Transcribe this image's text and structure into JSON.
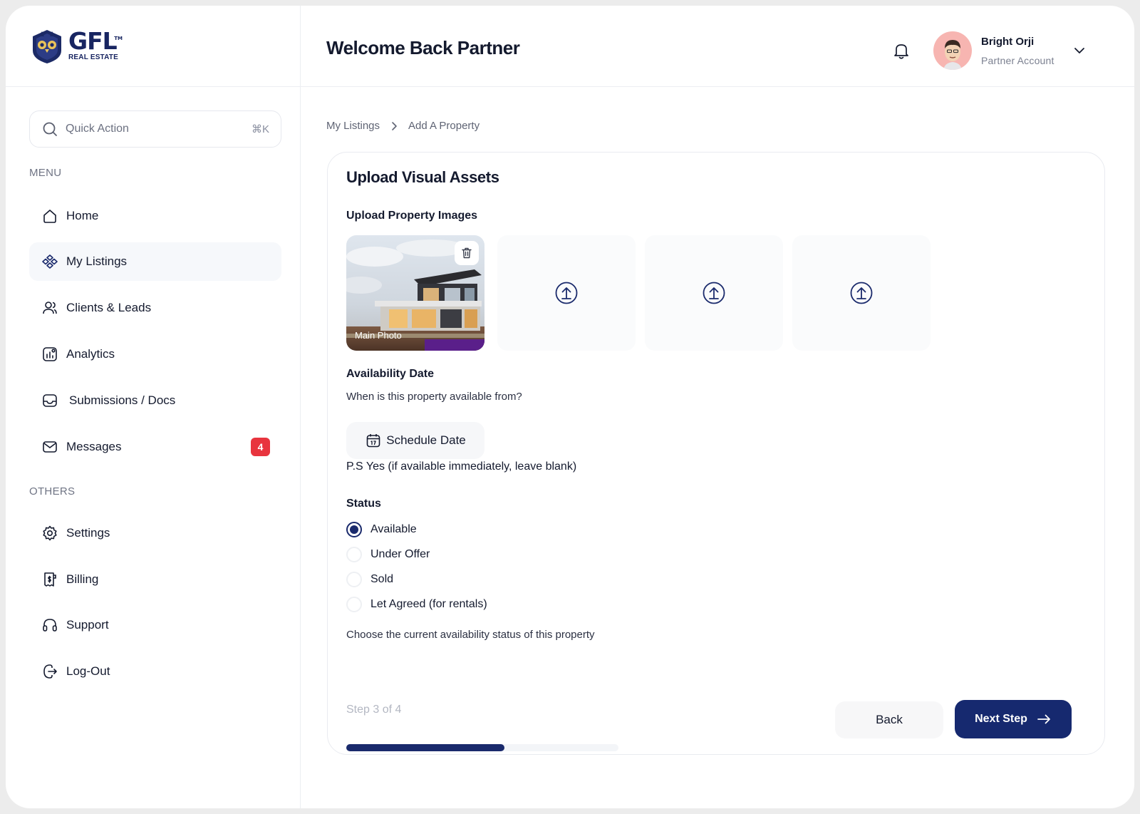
{
  "brand": {
    "name": "GFL",
    "trademark": "TM",
    "subtitle": "REAL ESTATE"
  },
  "header": {
    "title": "Welcome Back Partner",
    "user": {
      "name": "Bright Orji",
      "role": "Partner Account"
    }
  },
  "search": {
    "placeholder": "Quick Action",
    "shortcut": "⌘K"
  },
  "sidebar": {
    "menu_label": "MENU",
    "others_label": "OTHERS",
    "menu": [
      {
        "label": "Home",
        "icon": "home-icon"
      },
      {
        "label": "My Listings",
        "icon": "listings-icon",
        "active": true
      },
      {
        "label": "Clients & Leads",
        "icon": "users-icon"
      },
      {
        "label": "Analytics",
        "icon": "analytics-icon"
      },
      {
        "label": "Submissions / Docs",
        "icon": "inbox-icon"
      },
      {
        "label": "Messages",
        "icon": "mail-icon",
        "badge": "4"
      }
    ],
    "others": [
      {
        "label": "Settings",
        "icon": "gear-icon"
      },
      {
        "label": "Billing",
        "icon": "receipt-icon"
      },
      {
        "label": "Support",
        "icon": "headset-icon"
      },
      {
        "label": "Log-Out",
        "icon": "logout-icon"
      }
    ]
  },
  "breadcrumb": {
    "items": [
      "My Listings",
      "Add A Property"
    ]
  },
  "form": {
    "title": "Upload Visual Assets",
    "images_label": "Upload Property Images",
    "main_photo_label": "Main Photo",
    "availability": {
      "label": "Availability Date",
      "question": "When is this property available from?",
      "button": "Schedule Date",
      "note": "P.S Yes (if available immediately, leave blank)"
    },
    "status": {
      "label": "Status",
      "selected": "Available",
      "options": [
        "Available",
        "Under Offer",
        "Sold",
        "Let Agreed (for rentals)"
      ],
      "help": "Choose the current availability status of this property"
    }
  },
  "footer": {
    "step_text": "Step 3 of 4",
    "progress_fraction": 0.58,
    "back_label": "Back",
    "next_label": "Next Step"
  },
  "colors": {
    "primary": "#16296F",
    "badge": "#E8343E",
    "avatar_bg": "#F7B5B1"
  }
}
